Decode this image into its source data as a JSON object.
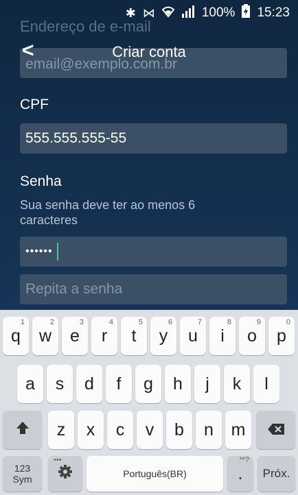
{
  "status_bar": {
    "bluetooth_icon": "bluetooth-icon",
    "vibrate_icon": "vibrate-icon",
    "wifi_icon": "wifi-icon",
    "signal_icon": "signal-icon",
    "battery": "100%",
    "time": "15:23"
  },
  "header": {
    "back_label": "<",
    "title": "Criar conta"
  },
  "form": {
    "email_label_partial": "Endereço de e-mail",
    "email_placeholder": "email@exemplo.com.br",
    "cpf_label": "CPF",
    "cpf_value": "555.555.555-55",
    "password_label": "Senha",
    "password_hint": "Sua senha deve ter ao menos 6 caracteres",
    "password_value": "••••••",
    "repeat_placeholder": "Repita a senha"
  },
  "keyboard": {
    "row1": [
      {
        "k": "q",
        "n": "1"
      },
      {
        "k": "w",
        "n": "2"
      },
      {
        "k": "e",
        "n": "3"
      },
      {
        "k": "r",
        "n": "4"
      },
      {
        "k": "t",
        "n": "5"
      },
      {
        "k": "y",
        "n": "6"
      },
      {
        "k": "u",
        "n": "7"
      },
      {
        "k": "i",
        "n": "8"
      },
      {
        "k": "o",
        "n": "9"
      },
      {
        "k": "p",
        "n": "0"
      }
    ],
    "row2": [
      "a",
      "s",
      "d",
      "f",
      "g",
      "h",
      "j",
      "k",
      "l"
    ],
    "row3": [
      "z",
      "x",
      "c",
      "v",
      "b",
      "n",
      "m"
    ],
    "shift_icon": "shift-icon",
    "backspace_icon": "backspace-icon",
    "sym_line1": "123",
    "sym_line2": "Sym",
    "settings_icon": "gear-icon",
    "settings_hint": "•••",
    "space_label": "Português(BR)",
    "period_label": ".",
    "period_hint": "**?",
    "next_label": "Próx."
  }
}
